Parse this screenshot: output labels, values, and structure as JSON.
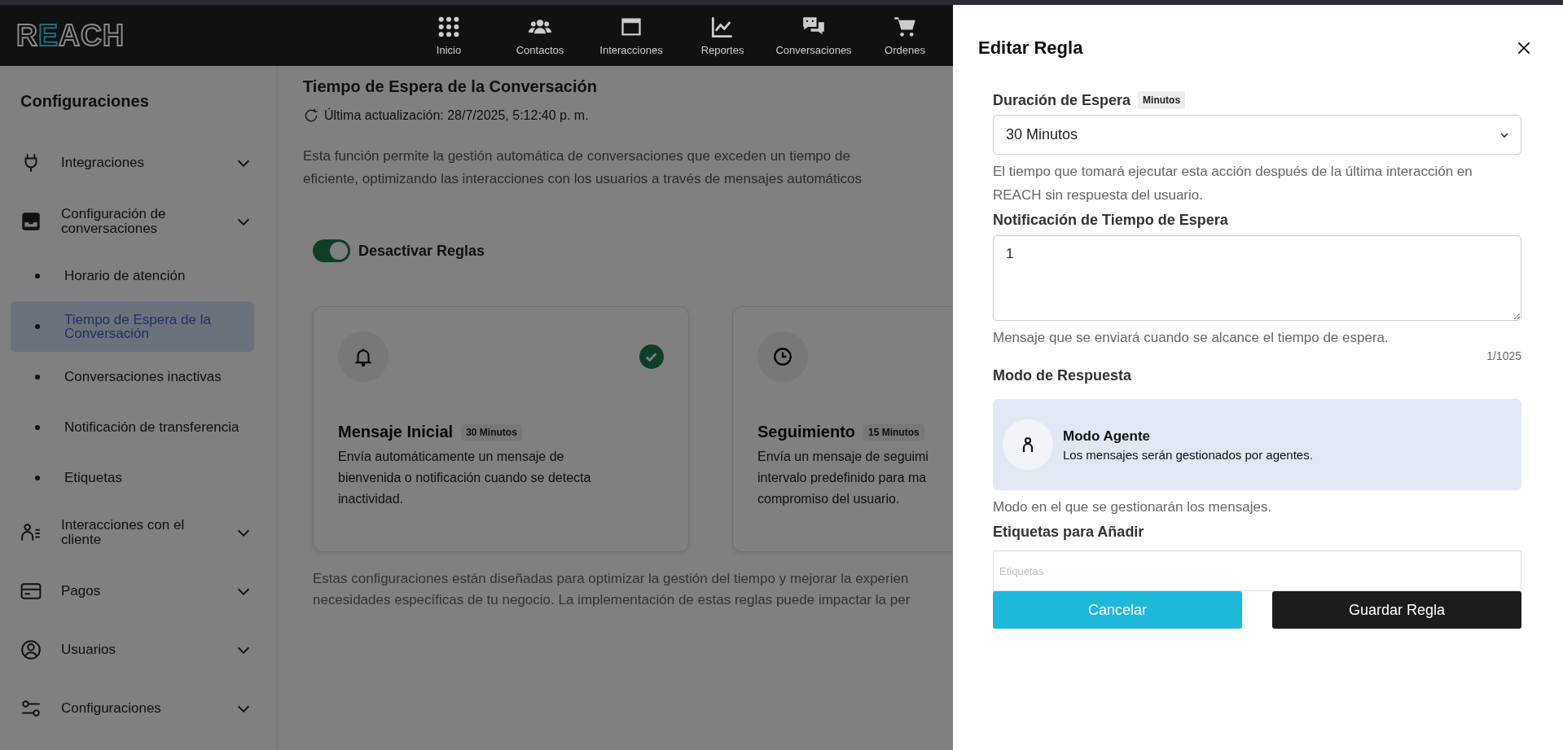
{
  "header": {
    "logo": "REACH",
    "nav": [
      {
        "label": "Inicio",
        "kind": "grid"
      },
      {
        "label": "Contactos",
        "kind": "people"
      },
      {
        "label": "Interacciones",
        "kind": "window"
      },
      {
        "label": "Reportes",
        "kind": "chart"
      },
      {
        "label": "Conversaciones",
        "kind": "chat"
      },
      {
        "label": "Ordenes",
        "kind": "cart"
      }
    ]
  },
  "sidebar": {
    "title": "Configuraciones",
    "items": [
      {
        "label": "Integraciones",
        "kind": "plug"
      },
      {
        "label": "Configuración de conversaciones",
        "kind": "inbox",
        "children": [
          {
            "label": "Horario de atención",
            "selected": false
          },
          {
            "label": "Tiempo de Espera de la Conversación",
            "selected": true
          },
          {
            "label": "Conversaciones inactivas",
            "selected": false
          },
          {
            "label": "Notificación de transferencia",
            "selected": false
          },
          {
            "label": "Etiquetas",
            "selected": false
          }
        ]
      },
      {
        "label": "Interacciones con el cliente",
        "kind": "userlist"
      },
      {
        "label": "Pagos",
        "kind": "card"
      },
      {
        "label": "Usuarios",
        "kind": "user"
      },
      {
        "label": "Configuraciones",
        "kind": "sliders"
      }
    ]
  },
  "main": {
    "title": "Tiempo de Espera de la Conversación",
    "updated": "Última actualización: 28/7/2025, 5:12:40 p. m.",
    "description": [
      "Esta función permite la gestión automática de conversaciones que exceden un tiempo de",
      "eficiente, optimizando las interacciones con los usuarios a través de mensajes automáticos"
    ],
    "toggle": {
      "label": "Desactivar Reglas",
      "on": true
    },
    "cards": [
      {
        "kind": "bell",
        "done": true,
        "title": "Mensaje Inicial",
        "badge": "30 Minutos",
        "lines": [
          "Envía automáticamente un mensaje de",
          "bienvenida o notificación cuando se detecta",
          "inactividad."
        ]
      },
      {
        "kind": "clock",
        "title": "Seguimiento",
        "badge": "15 Minutos",
        "lines": [
          "Envía un mensaje de seguimi",
          "intervalo predefinido para ma",
          "compromiso del usuario."
        ]
      }
    ],
    "footnote": [
      "Estas configuraciones están diseñadas para optimizar la gestión del tiempo y mejorar la experien",
      "necesidades específicas de tu negocio. La implementación de estas reglas puede impactar la per"
    ]
  },
  "drawer": {
    "title": "Editar Regla",
    "duration": {
      "label": "Duración de Espera",
      "badge": "Minutos",
      "value": "30 Minutos",
      "help": "El tiempo que tomará ejecutar esta acción después de la última interacción en REACH sin respuesta del usuario."
    },
    "notification": {
      "label": "Notificación de Tiempo de Espera",
      "value": "1",
      "help": "Mensaje que se enviará cuando se alcance el tiempo de espera.",
      "counter": "1/1025"
    },
    "mode": {
      "label": "Modo de Respuesta",
      "title": "Modo Agente",
      "text": "Los mensajes serán gestionados por agentes.",
      "help": "Modo en el que se gestionarán los mensajes."
    },
    "tags": {
      "label": "Etiquetas para Añadir",
      "placeholder": "Etiquetas"
    },
    "buttons": [
      {
        "label": "Cancelar",
        "kind": "secondary"
      },
      {
        "label": "Guardar Regla",
        "kind": "primary"
      }
    ]
  }
}
